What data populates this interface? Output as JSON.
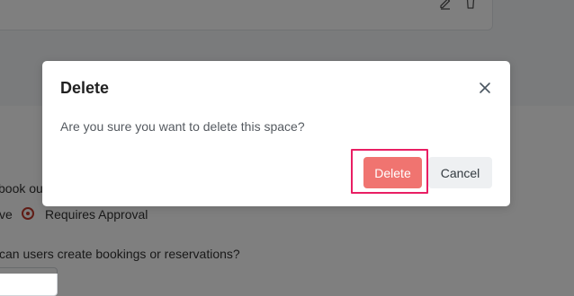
{
  "background": {
    "icons": [
      "edit-icon",
      "trash-icon"
    ],
    "booking_label_fragment": "book out",
    "radio_prev_fragment": "ve",
    "radio_label": "Requires Approval",
    "question_fragment": "can users create bookings or reservations?"
  },
  "modal": {
    "title": "Delete",
    "message": "Are you sure you want to delete this space?",
    "close_icon": "close-icon",
    "delete_label": "Delete",
    "cancel_label": "Cancel"
  },
  "colors": {
    "danger": "#f07470",
    "highlight": "#e91e63",
    "radio": "#c0392b"
  }
}
